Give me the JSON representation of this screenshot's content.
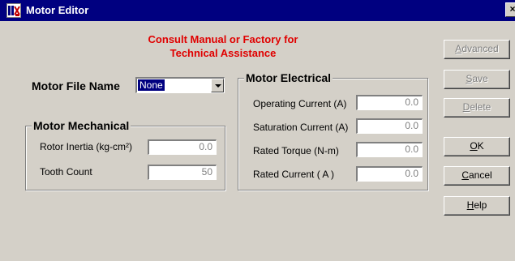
{
  "window": {
    "title": "Motor Editor",
    "close_glyph": "×",
    "icon": "motor-editor-app-icon"
  },
  "notice": {
    "line1": "Consult Manual or Factory for",
    "line2": "Technical Assistance",
    "color": "#e00000"
  },
  "motor_file": {
    "label": "Motor File Name",
    "selected": "None"
  },
  "mechanical": {
    "title": "Motor Mechanical",
    "rotor_inertia": {
      "label": "Rotor Inertia (kg-cm²)",
      "value": "0.0"
    },
    "tooth_count": {
      "label": "Tooth Count",
      "value": "50"
    }
  },
  "electrical": {
    "title": "Motor Electrical",
    "operating_current": {
      "label": "Operating Current  (A)",
      "value": "0.0"
    },
    "saturation_current": {
      "label": "Saturation Current (A)",
      "value": "0.0"
    },
    "rated_torque": {
      "label": "Rated Torque (N-m)",
      "value": "0.0"
    },
    "rated_current": {
      "label": "Rated Current ( A )",
      "value": "0.0"
    }
  },
  "buttons": {
    "advanced": {
      "mnemonic": "A",
      "rest": "dvanced",
      "enabled": false
    },
    "save": {
      "mnemonic": "S",
      "rest": "ave",
      "enabled": false
    },
    "delete": {
      "mnemonic": "D",
      "rest": "elete",
      "enabled": false
    },
    "ok": {
      "mnemonic": "O",
      "rest": "K",
      "enabled": true
    },
    "cancel": {
      "mnemonic": "C",
      "rest": "ancel",
      "enabled": true
    },
    "help": {
      "mnemonic": "H",
      "rest": "elp",
      "enabled": true
    }
  },
  "colors": {
    "titlebar": "#000080",
    "face": "#d4d0c8",
    "disabled_text": "#808080",
    "selection": "#000080"
  }
}
